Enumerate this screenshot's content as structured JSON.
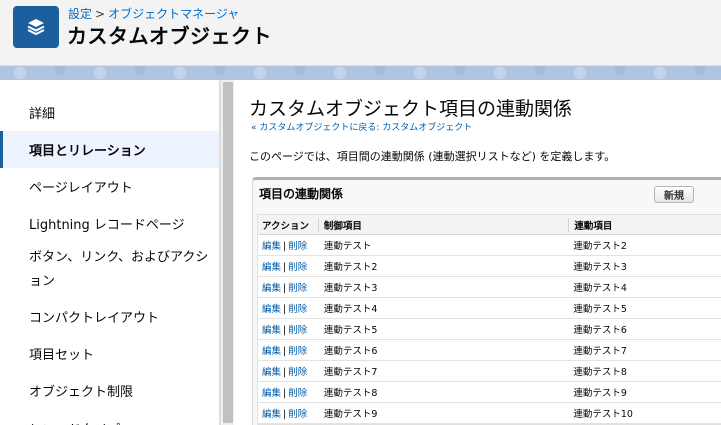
{
  "header": {
    "breadcrumb_parent": "設定",
    "breadcrumb_sep": ">",
    "breadcrumb_current": "オブジェクトマネージャ",
    "title": "カスタムオブジェクト",
    "app_icon": "layers-icon"
  },
  "sidebar": {
    "items": [
      {
        "label": "詳細"
      },
      {
        "label": "項目とリレーション"
      },
      {
        "label": "ページレイアウト"
      },
      {
        "label": "Lightning レコードページ"
      },
      {
        "label": "ボタン、リンク、およびアクション"
      },
      {
        "label": "コンパクトレイアウト"
      },
      {
        "label": "項目セット"
      },
      {
        "label": "オブジェクト制限"
      },
      {
        "label": "レコードタイプ"
      }
    ],
    "active_index": 1
  },
  "main": {
    "title": "カスタムオブジェクト項目の連動関係",
    "back_link": "« カスタムオブジェクトに戻る: カスタムオブジェクト",
    "description": "このページでは、項目間の連動関係 (連動選択リストなど) を定義します。",
    "panel": {
      "title": "項目の連動関係",
      "new_button": "新規",
      "columns": [
        "アクション",
        "制御項目",
        "連動項目"
      ],
      "edit_label": "編集",
      "delete_label": "削除",
      "separator": "|",
      "rows": [
        {
          "control": "連動テスト",
          "dependent": "連動テスト2"
        },
        {
          "control": "連動テスト2",
          "dependent": "連動テスト3"
        },
        {
          "control": "連動テスト3",
          "dependent": "連動テスト4"
        },
        {
          "control": "連動テスト4",
          "dependent": "連動テスト5"
        },
        {
          "control": "連動テスト5",
          "dependent": "連動テスト6"
        },
        {
          "control": "連動テスト6",
          "dependent": "連動テスト7"
        },
        {
          "control": "連動テスト7",
          "dependent": "連動テスト8"
        },
        {
          "control": "連動テスト8",
          "dependent": "連動テスト9"
        },
        {
          "control": "連動テスト9",
          "dependent": "連動テスト10"
        }
      ]
    }
  },
  "colors": {
    "brand": "#1b5f9e",
    "link": "#015ba7",
    "active_bg": "#eef4ff"
  }
}
